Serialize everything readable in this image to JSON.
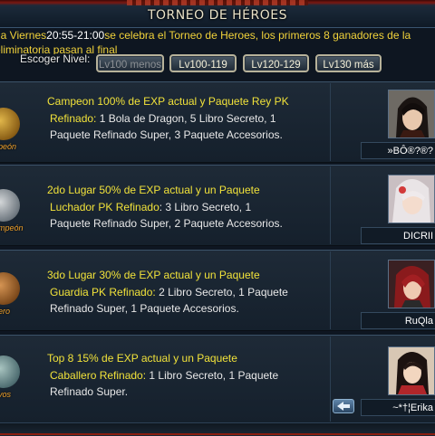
{
  "header": {
    "title": "TORNEO DE HÉROES"
  },
  "announcement": {
    "part1": "la Viernes",
    "time": "20:55-21:00",
    "part2": "se celebra el Torneo de Heroes, los primeros 8 ganadores de la",
    "line2": "eliminatoria pasan al final"
  },
  "level_selector": {
    "label": "Escoger Nivel:",
    "buttons": [
      "Lv100 menos",
      "Lv100-119",
      "Lv120-129",
      "Lv130 más"
    ],
    "selected": "Lv100 menos"
  },
  "rows": [
    {
      "medal_label": "peón",
      "medal_icon": "gold-medal-icon",
      "head": "Campeon  100% de EXP actual y Paquete Rey PK",
      "reward_key": "Refinado:",
      "reward_rest": " 1 Bola de Dragon, 5 Libro Secreto, 1",
      "line3": "Paquete Refinado Super, 3 Paquete Accesorios.",
      "player": "»BÔ®?®?"
    },
    {
      "medal_label": "mpeón",
      "medal_icon": "silver-medal-icon",
      "head": "2do Lugar 50% de EXP actual y un Paquete",
      "reward_key": "Luchador PK Refinado",
      "reward_rest": ": 3 Libro Secreto, 1",
      "line3": "Paquete Refinado Super, 2 Paquete Accesorios.",
      "player": "DICRII"
    },
    {
      "medal_label": "ero",
      "medal_icon": "bronze-medal-icon",
      "head": "3do Lugar 30% de EXP actual y un Paquete",
      "reward_key": "Guardia PK Refinado:",
      "reward_rest": " 2 Libro Secreto, 1 Paquete",
      "line3": "Refinado Super, 1 Paquete Accesorios.",
      "player": "RuQla"
    },
    {
      "medal_label": "vos",
      "medal_icon": "jade-medal-icon",
      "head": "Top 8     15% de EXP actual y un Paquete",
      "reward_key": "Caballero Refinado:",
      "reward_rest": " 1 Libro Secreto, 1 Paquete",
      "line3": "Refinado Super.",
      "player": "~*†¦Erika"
    }
  ],
  "colors": {
    "accent_yellow": "#f1e23a",
    "panel": "#1a2532",
    "border": "#3c5369"
  }
}
